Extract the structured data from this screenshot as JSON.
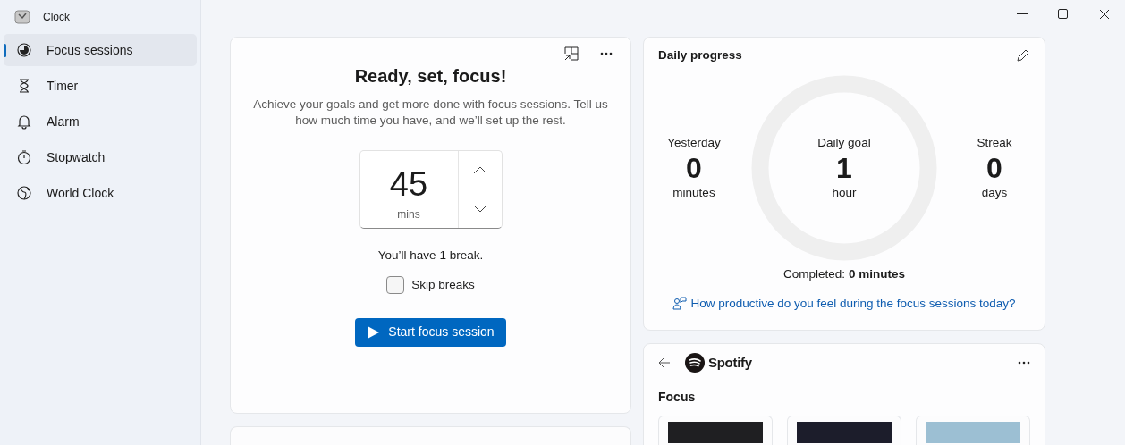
{
  "app_title": "Clock",
  "nav": [
    {
      "label": "Focus sessions",
      "selected": true
    },
    {
      "label": "Timer",
      "selected": false
    },
    {
      "label": "Alarm",
      "selected": false
    },
    {
      "label": "Stopwatch",
      "selected": false
    },
    {
      "label": "World Clock",
      "selected": false
    }
  ],
  "focus": {
    "title": "Ready, set, focus!",
    "description": "Achieve your goals and get more done with focus sessions. Tell us how much time you have, and we’ll set up the rest.",
    "minutes": "45",
    "unit": "mins",
    "breaks_note": "You’ll have 1 break.",
    "skip_breaks": {
      "label": "Skip breaks",
      "checked": false
    },
    "start_button": "Start focus session"
  },
  "daily_progress": {
    "title": "Daily progress",
    "yesterday": {
      "label": "Yesterday",
      "value": "0",
      "unit": "minutes"
    },
    "goal": {
      "label": "Daily goal",
      "value": "1",
      "unit": "hour"
    },
    "streak": {
      "label": "Streak",
      "value": "0",
      "unit": "days"
    },
    "completed": "Completed: **0 minutes**",
    "feedback_link": "How productive do you feel during the focus sessions today?"
  },
  "spotify": {
    "brand": "Spotify",
    "section": "Focus"
  }
}
